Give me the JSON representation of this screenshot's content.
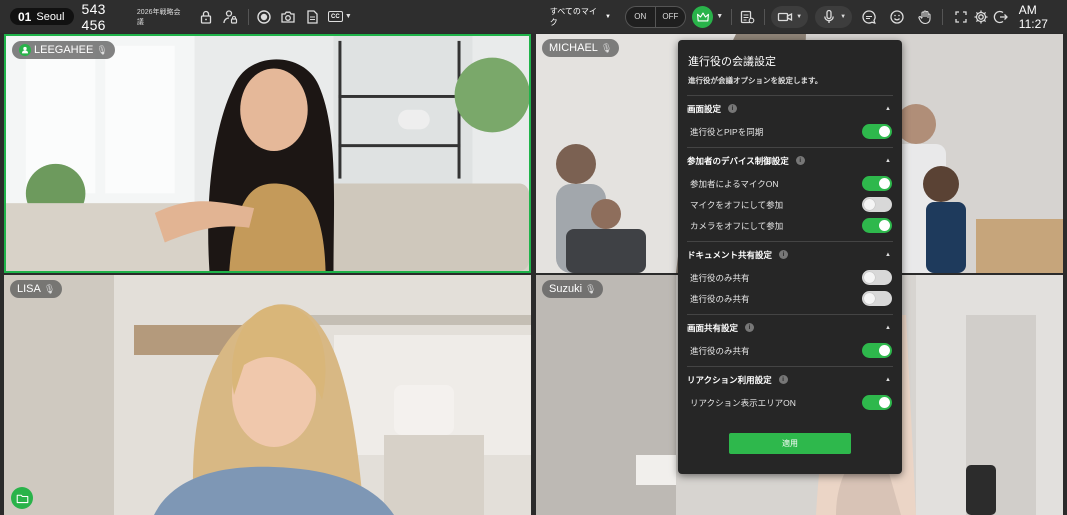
{
  "topbar": {
    "room_number": "01",
    "room_city": "Seoul",
    "meeting_id": "543 456",
    "meeting_name": "2026年戦略会議",
    "mic_filter_label": "すべてのマイク",
    "on_label": "ON",
    "off_label": "OFF",
    "cc_label": "CC",
    "clock": "AM 11:27"
  },
  "participants": [
    {
      "name": "LEEGAHEE",
      "active_speaker": true
    },
    {
      "name": "MICHAEL"
    },
    {
      "name": "LISA"
    },
    {
      "name": "Suzuki"
    }
  ],
  "panel": {
    "title": "進行役の会議設定",
    "subtitle": "進行役が会議オプションを設定します。",
    "sections": [
      {
        "title": "画面設定",
        "rows": [
          {
            "label": "進行役とPIPを同期",
            "on": true
          }
        ]
      },
      {
        "title": "参加者のデバイス制御設定",
        "rows": [
          {
            "label": "参加者によるマイクON",
            "on": true
          },
          {
            "label": "マイクをオフにして参加",
            "on": false
          },
          {
            "label": "カメラをオフにして参加",
            "on": true
          }
        ]
      },
      {
        "title": "ドキュメント共有設定",
        "rows": [
          {
            "label": "進行役のみ共有",
            "on": false
          },
          {
            "label": "進行役のみ共有",
            "on": false
          }
        ]
      },
      {
        "title": "画面共有設定",
        "rows": [
          {
            "label": "進行役のみ共有",
            "on": true
          }
        ]
      },
      {
        "title": "リアクション利用設定",
        "rows": [
          {
            "label": "リアクション表示エリアON",
            "on": true
          }
        ]
      }
    ],
    "apply_label": "適用"
  },
  "colors": {
    "accent": "#2eb84c",
    "active_border": "#1fb34a",
    "panel_bg": "#262626",
    "topbar_bg": "#2e2e2e"
  }
}
